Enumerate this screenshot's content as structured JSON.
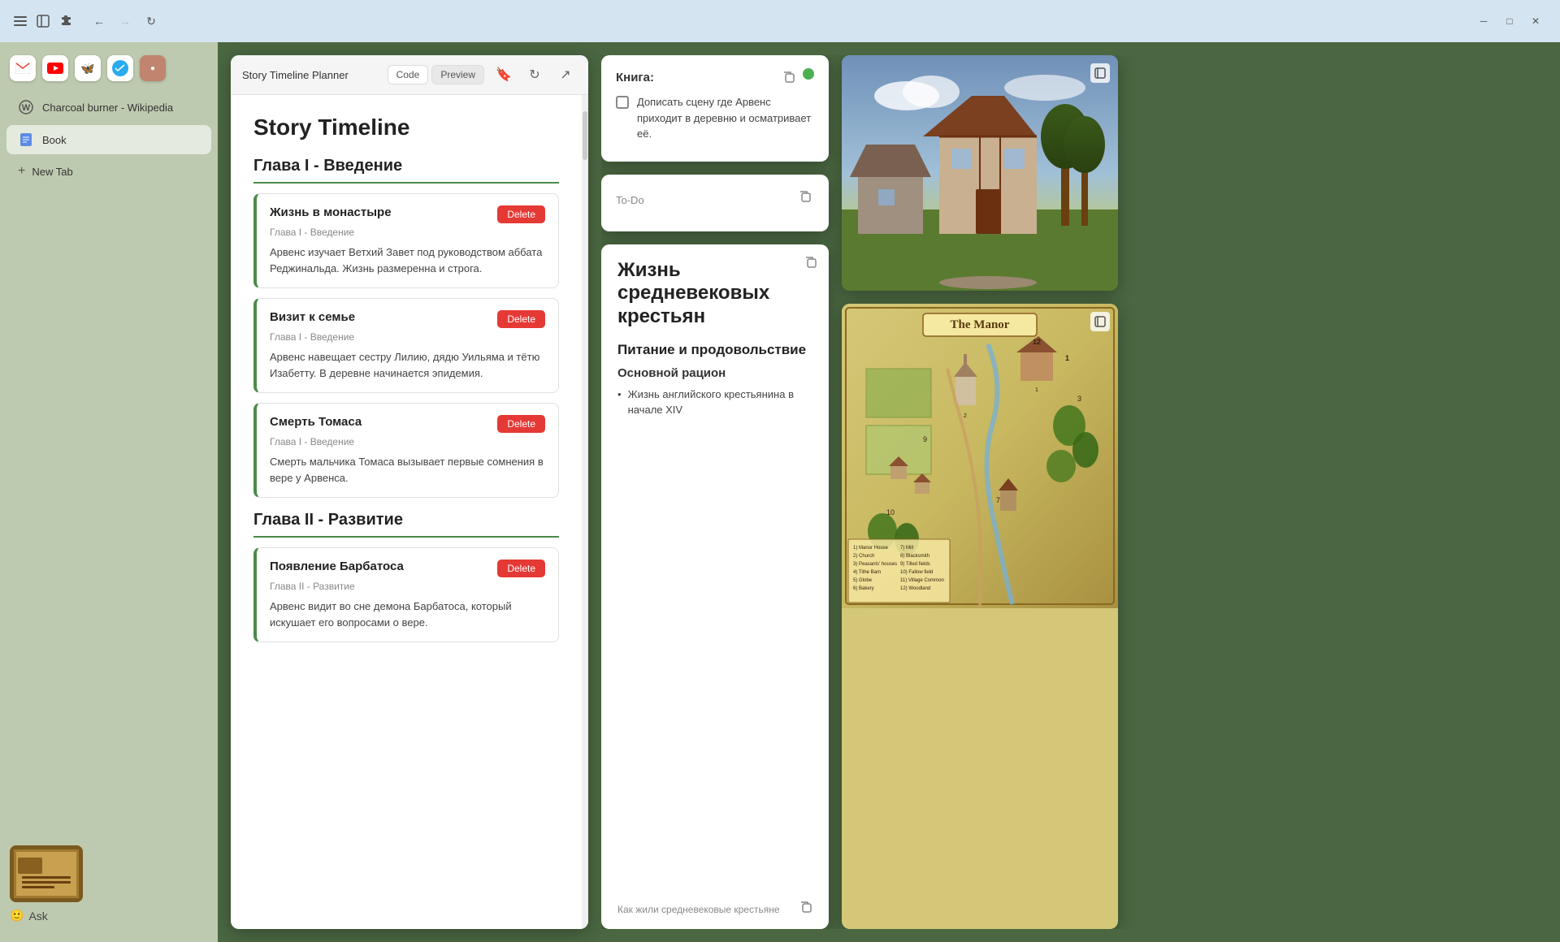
{
  "titlebar": {
    "menu_icon": "☰",
    "sidebar_icon": "⊡",
    "extensions_icon": "⚙",
    "back_icon": "←",
    "forward_icon": "→",
    "refresh_icon": "↻",
    "minimize": "─",
    "maximize": "□",
    "close": "✕"
  },
  "favicons": [
    {
      "id": "gmail",
      "icon": "M",
      "color": "#EA4335",
      "bg": "white"
    },
    {
      "id": "youtube",
      "icon": "▶",
      "color": "#FF0000",
      "bg": "white"
    },
    {
      "id": "bluesky",
      "icon": "🦋",
      "color": "#0085FF",
      "bg": "white"
    },
    {
      "id": "telegram",
      "icon": "✈",
      "color": "#2AABEE",
      "bg": "white"
    },
    {
      "id": "extra",
      "icon": "●",
      "color": "#fff",
      "bg": "#c0856e"
    }
  ],
  "sidebar": {
    "tabs": [
      {
        "id": "charcoal",
        "label": "Charcoal burner - Wikipedia",
        "icon": "W"
      },
      {
        "id": "book",
        "label": "Book",
        "icon": "📘"
      }
    ],
    "new_tab_label": "New Tab",
    "ask_label": "Ask"
  },
  "timeline_panel": {
    "title": "Story Timeline Planner",
    "code_btn": "Code",
    "preview_btn": "Preview",
    "main_title": "Story Timeline",
    "chapters": [
      {
        "id": "ch1",
        "title": "Глава I - Введение",
        "events": [
          {
            "title": "Жизнь в монастыре",
            "chapter_label": "Глава I - Введение",
            "description": "Арвенс изучает Ветхий Завет под руководством аббата Реджинальда. Жизнь размеренна и строга.",
            "delete_label": "Delete"
          },
          {
            "title": "Визит к семье",
            "chapter_label": "Глава I - Введение",
            "description": "Арвенс навещает сестру Лилию, дядю Уильяма и тётю Изабетту. В деревне начинается эпидемия.",
            "delete_label": "Delete"
          },
          {
            "title": "Смерть Томаса",
            "chapter_label": "Глава I - Введение",
            "description": "Смерть мальчика Томаса вызывает первые сомнения в вере у Арвенса.",
            "delete_label": "Delete"
          }
        ]
      },
      {
        "id": "ch2",
        "title": "Глава II - Развитие",
        "events": [
          {
            "title": "Появление Барбатоса",
            "chapter_label": "Глава II - Развитие",
            "description": "Арвенс видит во сне демона Барбатоса, который искушает его вопросами о вере.",
            "delete_label": "Delete"
          }
        ]
      }
    ]
  },
  "book_note": {
    "title": "Книга:",
    "todo_icon": "□",
    "green_dot": true,
    "checkbox_item": "Дописать сцену где Арвенс приходит в деревню и осматривает её."
  },
  "todo_note": {
    "label": "To-Do"
  },
  "medieval_card": {
    "title": "Жизнь средневековых крестьян",
    "subtitle": "Питание и продовольствие",
    "section": "Основной рацион",
    "items": [
      "Жизнь английского крестьянина в начале XIV"
    ],
    "footer_text": "Как жили средневековые крестьяне"
  },
  "images": {
    "village_alt": "Medieval village illustration",
    "map_title": "The Manor",
    "map_legend": [
      "1) Manor House",
      "7) Mill",
      "2) Church",
      "8) Blacksmith",
      "3) Peasants' houses",
      "9) Tilled fields",
      "4) Tithe Barn",
      "10) Fallow field",
      "5) Globe",
      "11) Village Common",
      "6) Bakery",
      "12) Woodland"
    ]
  }
}
